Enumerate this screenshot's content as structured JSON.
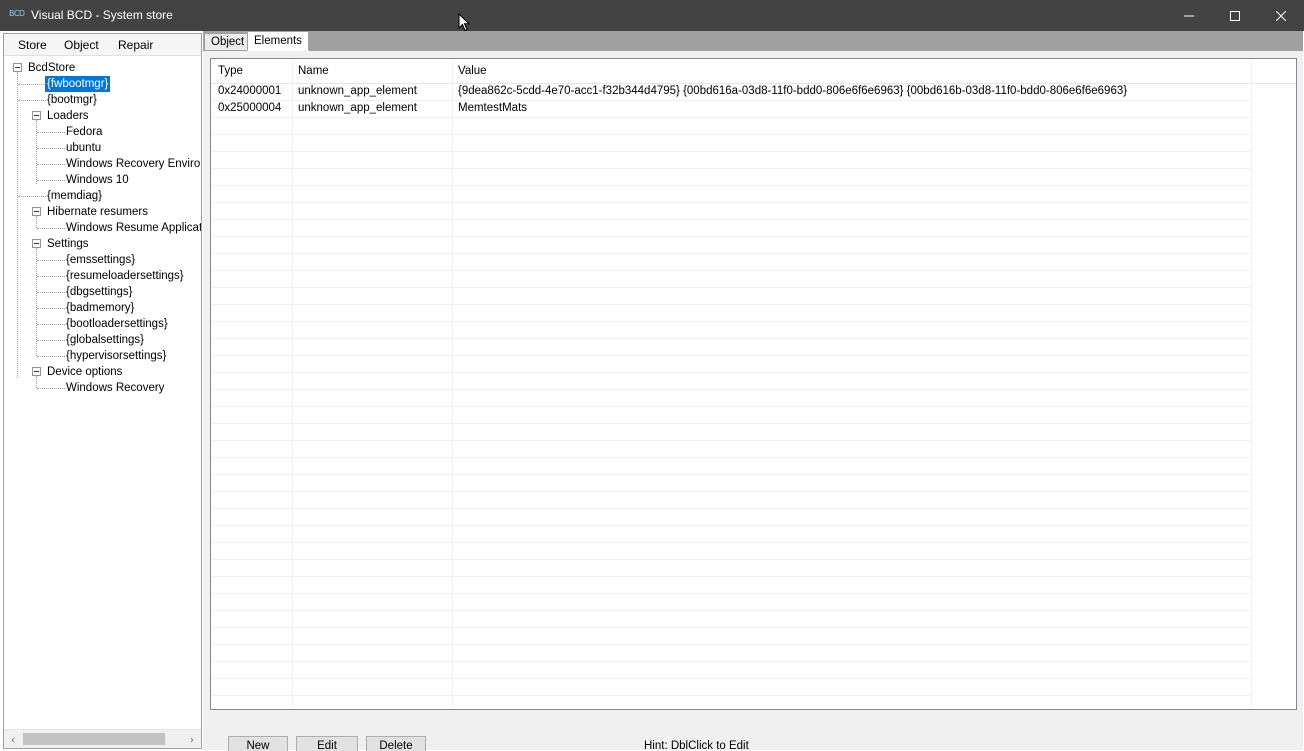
{
  "window": {
    "title": "Visual BCD - System store",
    "icon_text": "BCD"
  },
  "menu": {
    "items": [
      "Store",
      "Object",
      "Repair"
    ]
  },
  "tree": {
    "root": "BcdStore",
    "nodes": [
      "{fwbootmgr}",
      "{bootmgr}",
      "Loaders",
      "Fedora",
      "ubuntu",
      "Windows Recovery Environ",
      "Windows 10",
      "{memdiag}",
      "Hibernate resumers",
      "Windows Resume Applicatio",
      "Settings",
      "{emssettings}",
      "{resumeloadersettings}",
      "{dbgsettings}",
      "{badmemory}",
      "{bootloadersettings}",
      "{globalsettings}",
      "{hypervisorsettings}",
      "Device options",
      "Windows Recovery"
    ],
    "selected": "{fwbootmgr}"
  },
  "tabs": [
    "Object",
    "Elements"
  ],
  "active_tab": "Elements",
  "grid": {
    "columns": [
      "Type",
      "Name",
      "Value"
    ],
    "rows": [
      {
        "type": "0x24000001",
        "name": "unknown_app_element",
        "value": "{9dea862c-5cdd-4e70-acc1-f32b344d4795} {00bd616a-03d8-11f0-bdd0-806e6f6e6963} {00bd616b-03d8-11f0-bdd0-806e6f6e6963}"
      },
      {
        "type": "0x25000004",
        "name": "unknown_app_element",
        "value": "MemtestMats"
      }
    ]
  },
  "buttons": {
    "new": "New",
    "edit": "Edit",
    "delete": "Delete"
  },
  "hint": "Hint: DblClick to Edit",
  "icons": {
    "scroll_left": "‹",
    "scroll_right": "›"
  },
  "colors": {
    "titlebar": "#434343",
    "selection": "#0078d7"
  }
}
